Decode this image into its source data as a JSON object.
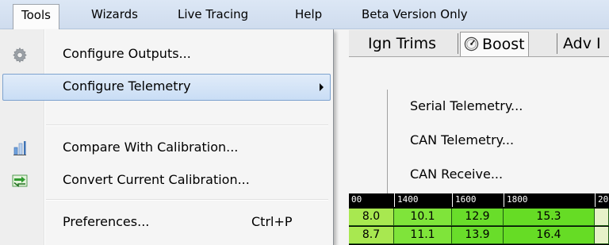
{
  "menubar": {
    "items": [
      {
        "label": "Tools"
      },
      {
        "label": "Wizards"
      },
      {
        "label": "Live Tracing"
      },
      {
        "label": "Help"
      },
      {
        "label": "Beta Version Only"
      }
    ]
  },
  "tabs": [
    {
      "label": "Ign Trims"
    },
    {
      "label": "Boost"
    },
    {
      "label": "Adv I"
    }
  ],
  "grid": {
    "headers": [
      "00",
      "1400",
      "1600",
      "1800",
      "20"
    ],
    "rows": [
      [
        "8.0",
        "10.1",
        "12.9",
        "15.3",
        ""
      ],
      [
        "8.7",
        "11.1",
        "13.9",
        "16.4",
        ""
      ]
    ]
  },
  "tools_menu": {
    "items": [
      {
        "label": "Configure Outputs...",
        "icon": "gear-icon"
      },
      {
        "label": "Configure Telemetry",
        "has_submenu": true,
        "highlighted": true
      },
      {
        "label": "Compare With Calibration...",
        "icon": "bar-chart-icon"
      },
      {
        "label": "Convert Current Calibration...",
        "icon": "convert-icon"
      },
      {
        "label": "Preferences...",
        "shortcut": "Ctrl+P"
      }
    ]
  },
  "telemetry_submenu": {
    "items": [
      {
        "label": "Serial Telemetry..."
      },
      {
        "label": "CAN Telemetry..."
      },
      {
        "label": "CAN Receive..."
      }
    ]
  },
  "colors": {
    "menu_highlight": "#c9ddf5",
    "menu_highlight_border": "#7da2ce",
    "grid_green": "#69dd2a"
  }
}
